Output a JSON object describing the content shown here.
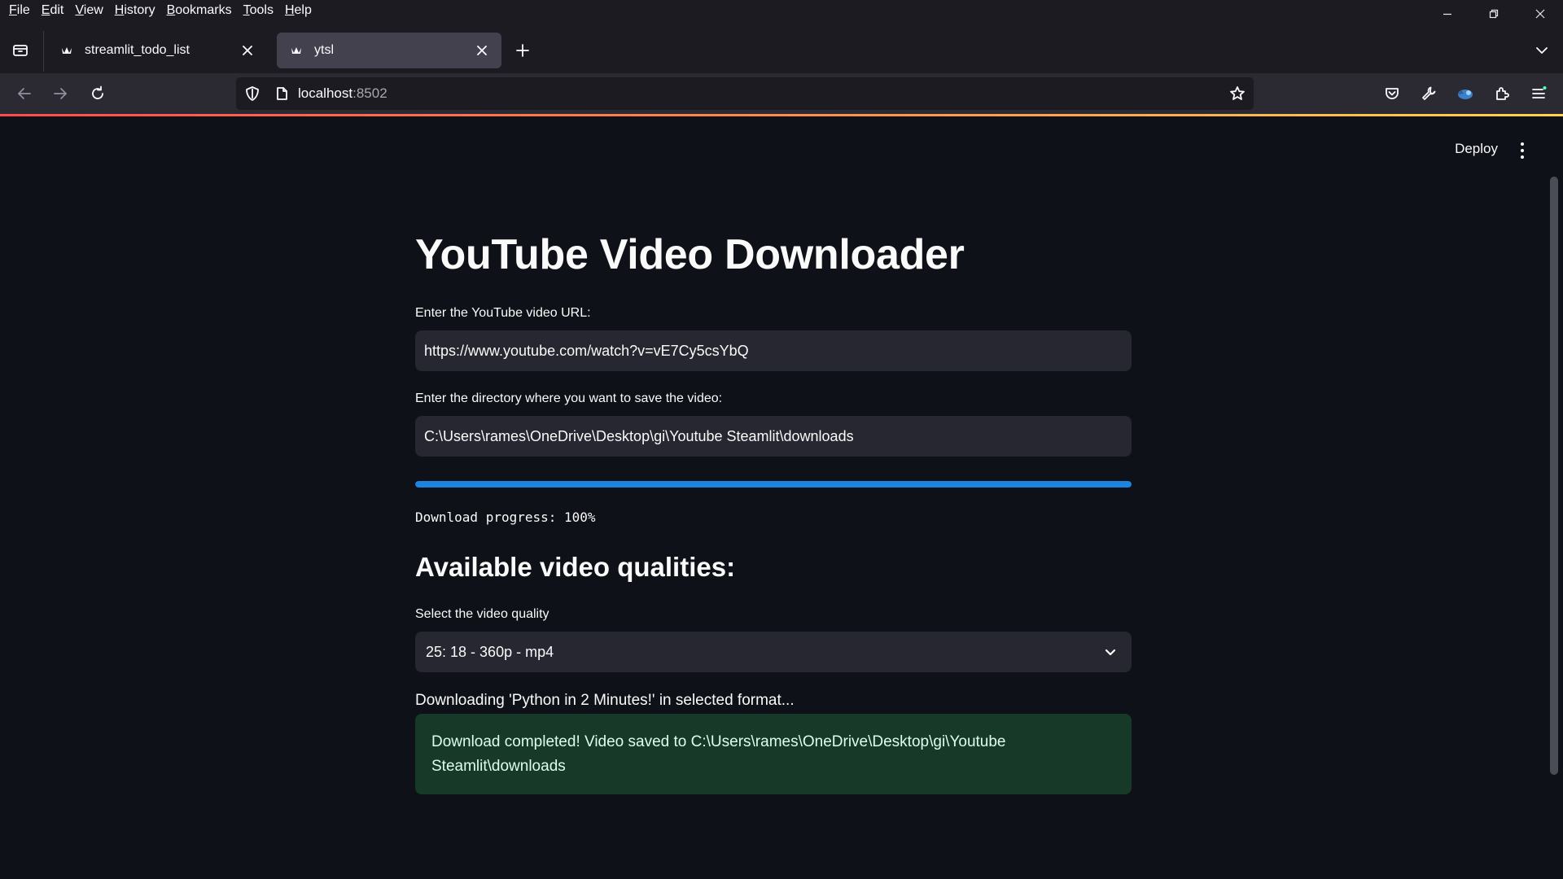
{
  "menubar": [
    "File",
    "Edit",
    "View",
    "History",
    "Bookmarks",
    "Tools",
    "Help"
  ],
  "tabs": [
    {
      "title": "streamlit_todo_list",
      "active": false
    },
    {
      "title": "ytsl",
      "active": true
    }
  ],
  "address": {
    "host": "localhost",
    "port": ":8502"
  },
  "app": {
    "deploy_label": "Deploy",
    "title": "YouTube Video Downloader",
    "url_label": "Enter the YouTube video URL:",
    "url_value": "https://www.youtube.com/watch?v=vE7Cy5csYbQ",
    "dir_label": "Enter the directory where you want to save the video:",
    "dir_value": "C:\\Users\\rames\\OneDrive\\Desktop\\gi\\Youtube Steamlit\\downloads",
    "progress": 1.0,
    "progress_text": "Download progress: 100%",
    "qualities_heading": "Available video qualities:",
    "select_label": "Select the video quality",
    "select_value": "25: 18 - 360p - mp4",
    "status_text": "Downloading 'Python in 2 Minutes!' in selected format...",
    "success_text": "Download completed! Video saved to C:\\Users\\rames\\OneDrive\\Desktop\\gi\\Youtube Steamlit\\downloads"
  },
  "colors": {
    "background": "#0e1117",
    "input_bg": "#262730",
    "progress": "#1c83e1",
    "success_bg": "#173928",
    "success_text": "#dffde9"
  },
  "icons": [
    "tab-list-icon",
    "streamlit-favicon",
    "close-icon",
    "plus-icon",
    "chevron-down-icon",
    "back-arrow-icon",
    "forward-arrow-icon",
    "reload-icon",
    "shield-icon",
    "page-icon",
    "star-icon",
    "pocket-icon",
    "wrench-icon",
    "extension-avatar-icon",
    "extensions-icon",
    "hamburger-menu-icon",
    "minimize-icon",
    "restore-icon",
    "kebab-menu-icon"
  ]
}
